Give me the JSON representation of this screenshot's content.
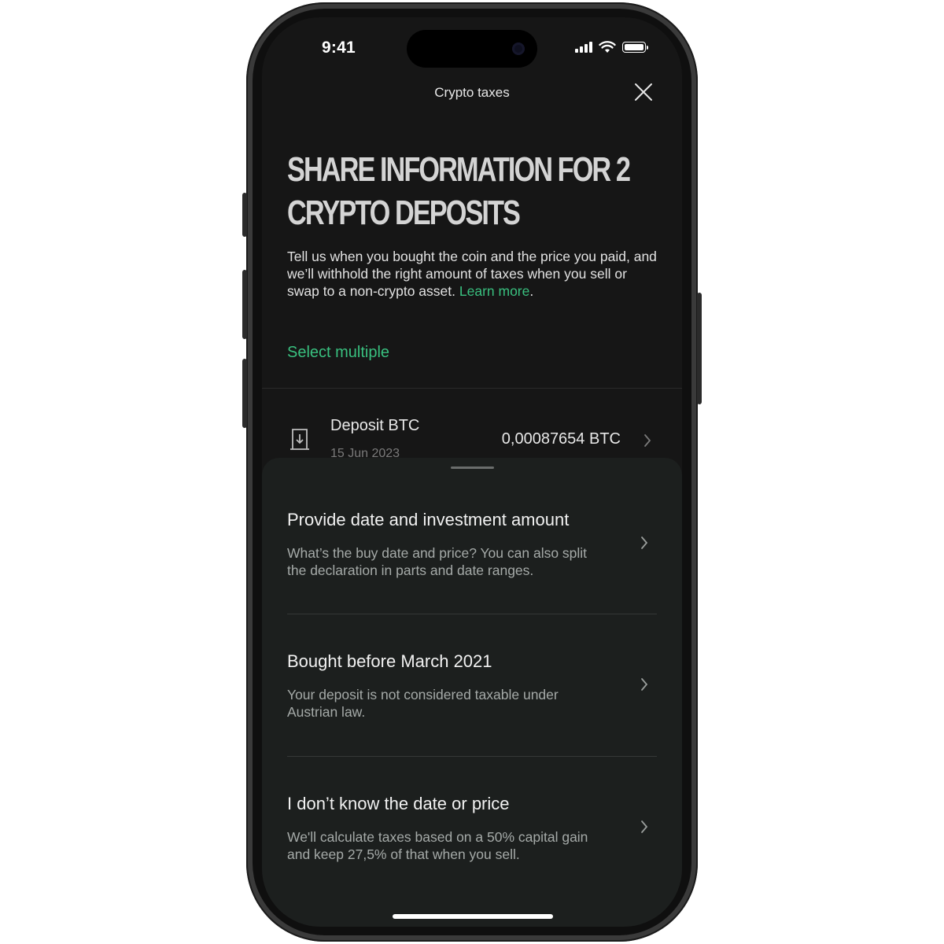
{
  "status_bar": {
    "time": "9:41"
  },
  "header": {
    "title": "Crypto taxes"
  },
  "heading": "Share information for 2 crypto deposits",
  "description": {
    "text": "Tell us when you bought the coin and the price you paid, and we’ll withhold the right amount of taxes when you sell or swap to a non-crypto asset.",
    "link": "Learn more",
    "end": "."
  },
  "select_multiple": "Select multiple",
  "deposit": {
    "title": "Deposit BTC",
    "date": "15 Jun 2023",
    "amount": "0,00087654 BTC"
  },
  "sheet": {
    "options": [
      {
        "title": "Provide date and investment amount",
        "description": "What’s the buy date and price? You can also split the declaration in parts and date ranges."
      },
      {
        "title": "Bought before March 2021",
        "description": "Your deposit is not considered taxable under Austrian law."
      },
      {
        "title": "I don’t know the date or price",
        "description": "We'll calculate taxes based on a 50% capital gain and keep 27,5% of that when you sell."
      }
    ]
  },
  "colors": {
    "accent": "#39c07f",
    "background": "#161616",
    "sheet": "#1c1f1e"
  }
}
